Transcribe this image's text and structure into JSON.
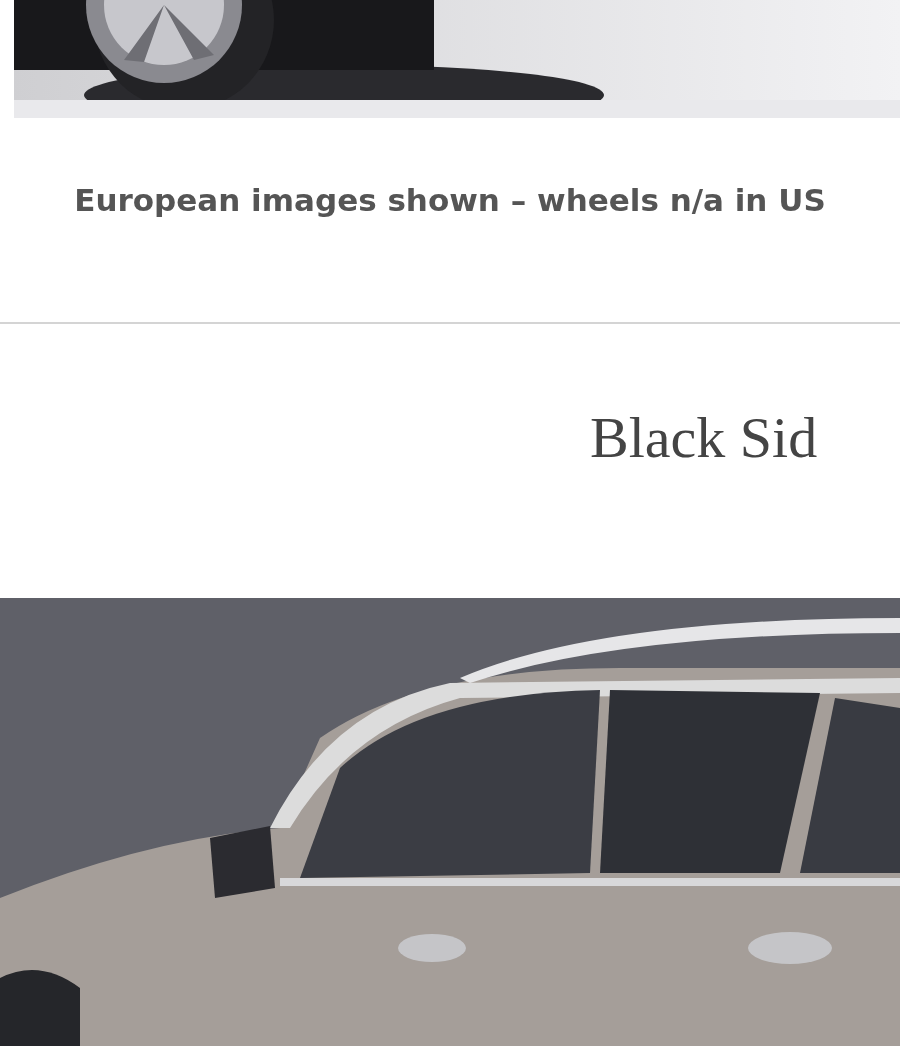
{
  "caption": "European images shown – wheels n/a in US",
  "section_heading": "Black Sid"
}
